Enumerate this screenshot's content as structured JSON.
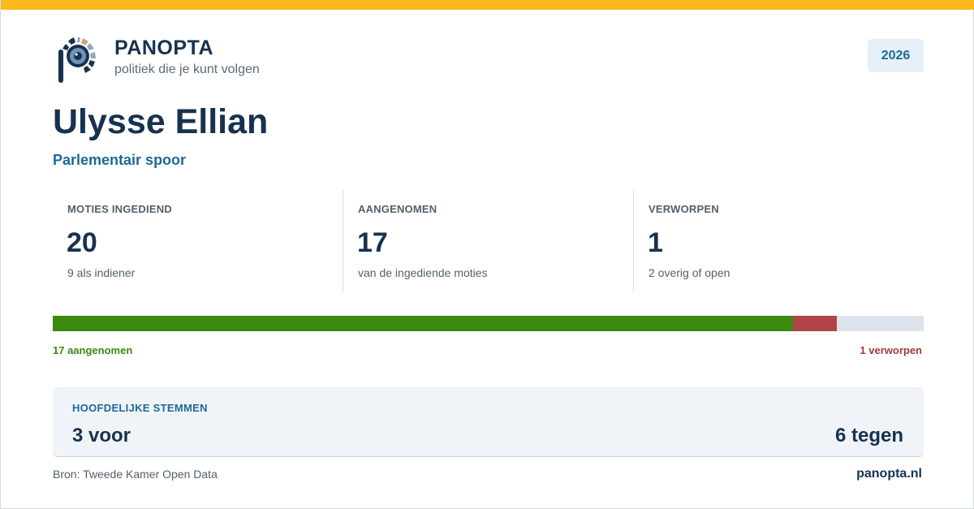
{
  "brand": {
    "name": "PANOPTA",
    "tagline": "politiek die je kunt volgen"
  },
  "year": "2026",
  "person": {
    "name": "Ulysse Ellian",
    "track": "Parlementair spoor"
  },
  "stats": [
    {
      "label": "MOTIES INGEDIEND",
      "value": "20",
      "sub": "9 als indiener"
    },
    {
      "label": "AANGENOMEN",
      "value": "17",
      "sub": "van de ingediende moties"
    },
    {
      "label": "VERWORPEN",
      "value": "1",
      "sub": "2 overig of open"
    }
  ],
  "progress": {
    "total": 20,
    "accepted": 17,
    "rejected": 1,
    "accepted_label": "17 aangenomen",
    "rejected_label": "1 verworpen",
    "colors": {
      "accepted": "#3a8a0f",
      "rejected": "#b04545",
      "rest": "#dde3ea"
    }
  },
  "votes": {
    "title": "HOOFDELIJKE STEMMEN",
    "for": "3 voor",
    "against": "6 tegen"
  },
  "footer": {
    "source": "Bron: Tweede Kamer Open Data",
    "site": "panopta.nl"
  },
  "colors": {
    "accent_bar": "#fbb91e",
    "navy": "#16324f",
    "blue": "#1b6a96"
  },
  "icons": {
    "logo": "panopta-eye-logo"
  }
}
